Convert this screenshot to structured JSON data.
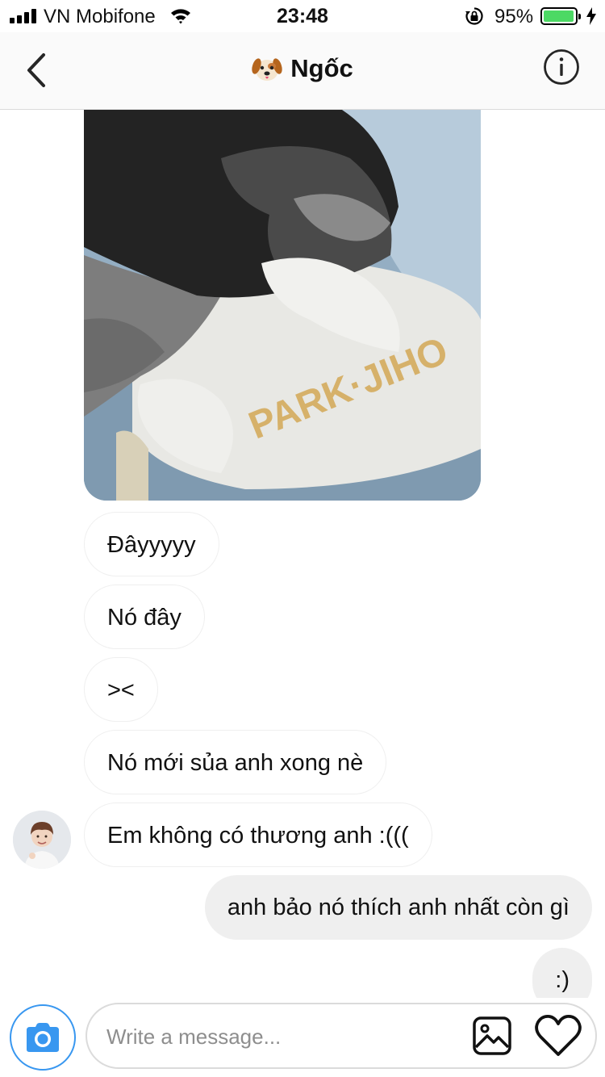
{
  "status_bar": {
    "carrier": "VN Mobifone",
    "time": "23:48",
    "battery": "95%",
    "battery_level": 0.95
  },
  "header": {
    "title": "Ngốc",
    "title_emoji_icon": "dog-face-icon",
    "back_icon": "chevron-left-icon",
    "info_icon": "info-icon"
  },
  "thread": {
    "photo_icon": "dog-photo",
    "incoming": [
      "Đâyyyyy",
      "Nó đây",
      "><",
      "Nó mới sủa anh xong nè",
      "Em không có thương anh :((("
    ],
    "outgoing": [
      "anh bảo nó thích anh nhất còn gì",
      ":)"
    ]
  },
  "composer": {
    "placeholder": "Write a message...",
    "camera_icon": "camera-icon",
    "gallery_icon": "gallery-icon",
    "like_icon": "heart-icon",
    "accent_color": "#3897f0"
  }
}
